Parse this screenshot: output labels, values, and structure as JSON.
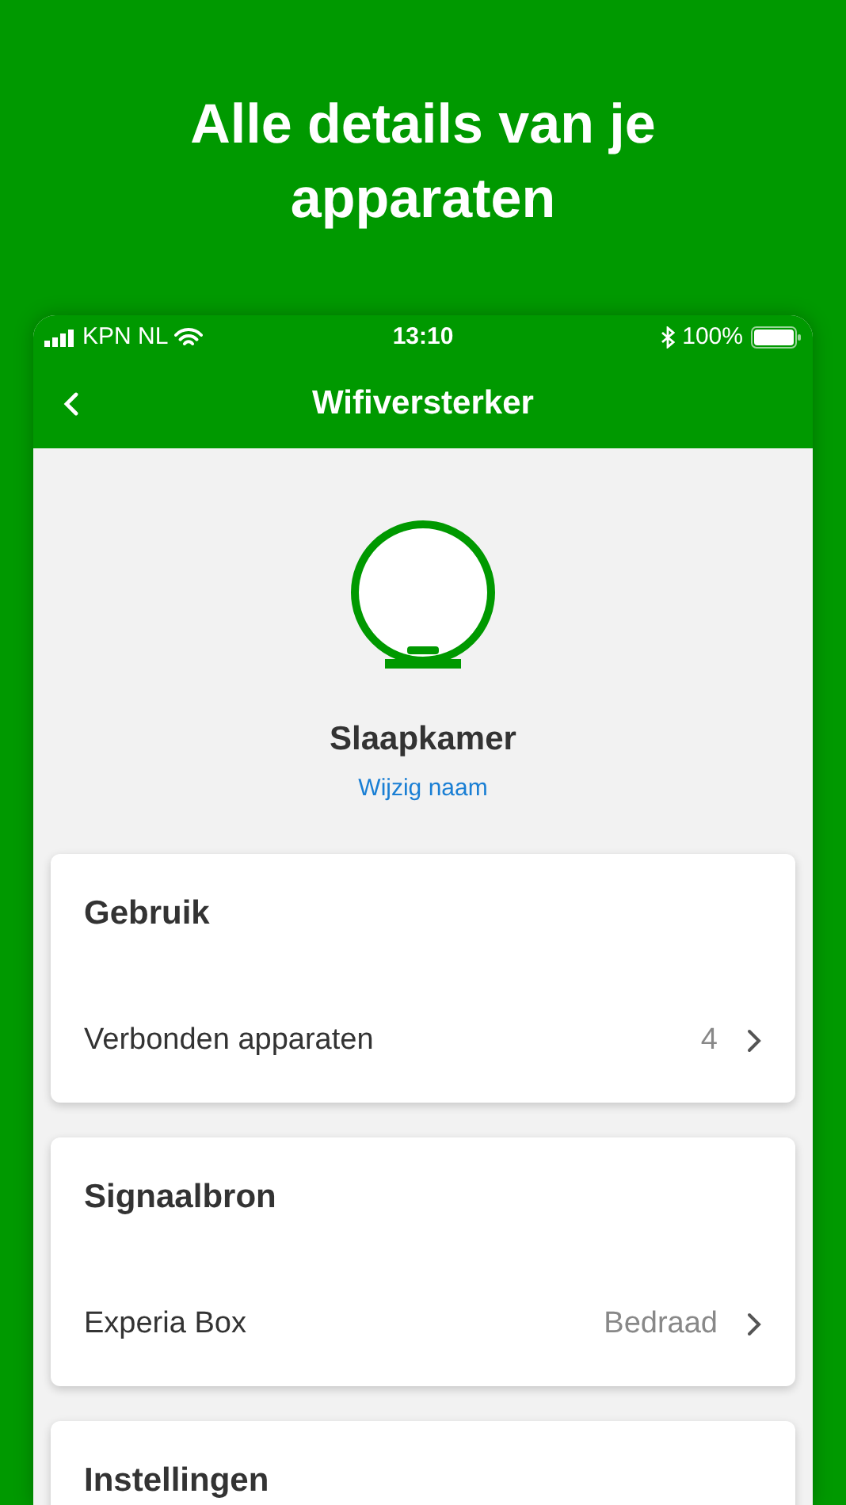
{
  "headline": "Alle details van je apparaten",
  "status_bar": {
    "carrier": "KPN NL",
    "time": "13:10",
    "battery": "100%"
  },
  "nav": {
    "title": "Wifiversterker"
  },
  "device": {
    "name": "Slaapkamer",
    "rename_link": "Wijzig naam"
  },
  "sections": [
    {
      "title": "Gebruik",
      "rows": [
        {
          "label": "Verbonden apparaten",
          "value": "4"
        }
      ]
    },
    {
      "title": "Signaalbron",
      "rows": [
        {
          "label": "Experia Box",
          "value": "Bedraad"
        }
      ]
    },
    {
      "title": "Instellingen"
    }
  ]
}
